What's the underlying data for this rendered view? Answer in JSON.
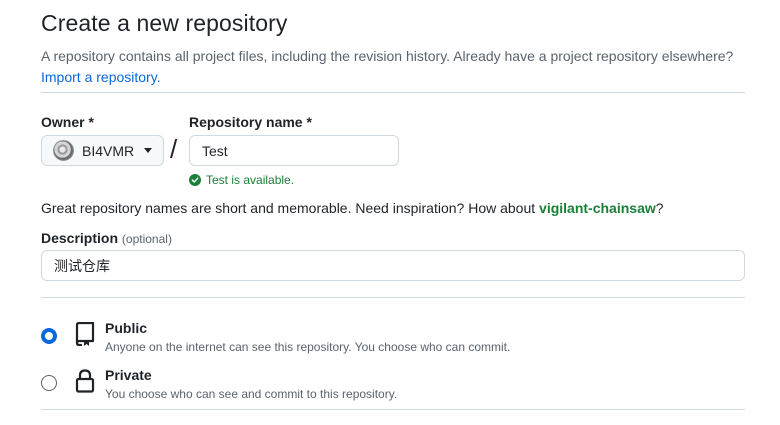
{
  "page": {
    "title": "Create a new repository",
    "subtitle": "A repository contains all project files, including the revision history. Already have a project repository elsewhere?",
    "import_link": "Import a repository."
  },
  "owner": {
    "label": "Owner *",
    "name": "BI4VMR"
  },
  "repo": {
    "label": "Repository name *",
    "value": "Test",
    "availability": "Test is available."
  },
  "hint": {
    "text": "Great repository names are short and memorable. Need inspiration? How about ",
    "suggestion": "vigilant-chainsaw",
    "end": "?"
  },
  "description": {
    "label": "Description",
    "optional": "(optional)",
    "value": "测试仓库"
  },
  "visibility": [
    {
      "title": "Public",
      "desc": "Anyone on the internet can see this repository. You choose who can commit.",
      "checked": true,
      "icon": "repo-icon"
    },
    {
      "title": "Private",
      "desc": "You choose who can see and commit to this repository.",
      "checked": false,
      "icon": "lock-icon"
    }
  ],
  "colors": {
    "accent": "#0969da",
    "success": "#1a7f37",
    "muted": "#59636e"
  }
}
